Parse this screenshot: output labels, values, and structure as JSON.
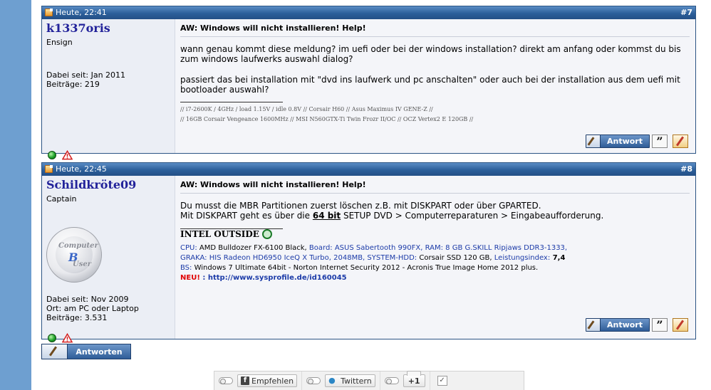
{
  "posts": [
    {
      "date": "Heute, 22:41",
      "number": "#7",
      "username": "k1337oris",
      "rank": "Ensign",
      "meta": [
        "Dabei seit: Jan 2011",
        "Beiträge: 219"
      ],
      "title": "AW: Windows will nicht installieren! Help!",
      "message": [
        "wann genau kommt diese meldung? im uefi oder bei der windows installation? direkt am anfang oder kommst du bis zum windows laufwerks auswahl dialog?",
        "passiert das bei installation mit \"dvd ins laufwerk und pc anschalten\" oder auch bei der installation aus dem uefi mit bootloader auswahl?"
      ],
      "signature": [
        "// i7-2600K / 4GHz / load 1.15V / idle 0.8V // Corsair H60 // Asus Maximus IV GENE-Z //",
        "// 16GB Corsair Vengeance 1600MHz // MSI N560GTX-Ti Twin Frozr II/OC // OCZ Vertex2 E 120GB //"
      ],
      "answer_label": "Antwort"
    },
    {
      "date": "Heute, 22:45",
      "number": "#8",
      "username": "Schildkröte09",
      "rank": "Captain",
      "meta": [
        "Dabei seit: Nov 2009",
        "Ort: am PC oder Laptop",
        "Beiträge: 3.531"
      ],
      "title": "AW: Windows will nicht installieren! Help!",
      "message_line1": "Du musst die MBR Partitionen zuerst löschen z.B. mit DISKPART oder über GPARTED.",
      "message_line2_a": "Mit DISKPART geht es über die ",
      "message_line2_bold": "64 bit",
      "message_line2_b": " SETUP DVD > Computerreparaturen > Eingabeaufforderung.",
      "sig_heading": "INTEL OUTSIDE",
      "hw": {
        "cpu_label": "CPU:",
        "cpu": " AMD Bulldozer FX-6100 Black,",
        "board_label": " Board:",
        "board": " ASUS Sabertooth 990FX,",
        "ram_label": " RAM:",
        "ram": " 8 GB G.SKILL Ripjaws DDR3-1333,",
        "graka_label": "GRAKA:",
        "graka": " HIS Radeon HD6950 IceQ X Turbo, 2048MB,",
        "hdd_label": " SYSTEM-HDD:",
        "hdd": " Corsair SSD 120 GB,",
        "score_label": " Leistungsindex:",
        "score": " 7,4",
        "bs_label": "BS:",
        "bs": " Windows 7 Ultimate 64bit - Norton Internet Security 2012 - Acronis True Image Home 2012 plus.",
        "neu": "NEU!",
        "neu_sep": " : ",
        "link": "http://www.sysprofile.de/id160045"
      },
      "avatar_text": [
        "Computer",
        "B",
        "User"
      ],
      "answer_label": "Antwort"
    }
  ],
  "reply_button": "Antworten",
  "social": {
    "facebook": "Empfehlen",
    "twitter": "Twittern",
    "gplus": "+1"
  },
  "icons": {
    "status": "online-icon",
    "warn": "report-warning-icon",
    "quote": "quote-icon",
    "edit": "edit-icon"
  },
  "colors": {
    "header": "#2c5f9a",
    "username": "#22229a",
    "background": "#6e9fd0"
  }
}
